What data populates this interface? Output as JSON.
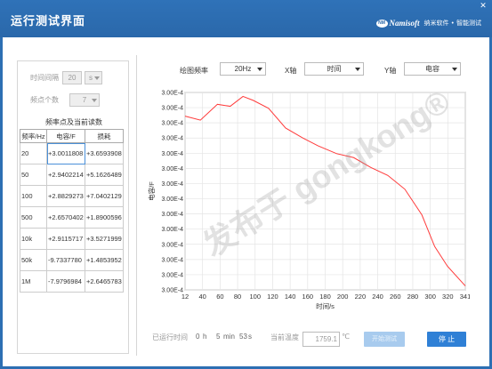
{
  "window": {
    "title": "运行测试界面",
    "close_glyph": "✕"
  },
  "brand": {
    "logo_text": "NM",
    "name": "Namisoft",
    "company": "纳米软件",
    "dot": "•",
    "product": "智能测试"
  },
  "left": {
    "interval": {
      "label": "时间间隔",
      "value": "20",
      "unit": "s"
    },
    "freq_count": {
      "label": "频点个数",
      "value": "7"
    },
    "table_title": "频率点及当前读数",
    "columns": [
      "频率/Hz",
      "电容/F",
      "损耗"
    ],
    "rows": [
      [
        "20",
        "+3.0011808",
        "+3.6593908"
      ],
      [
        "50",
        "+2.9402214",
        "+5.1626489"
      ],
      [
        "100",
        "+2.8829273",
        "+7.0402129"
      ],
      [
        "500",
        "+2.6570402",
        "+1.8900596"
      ],
      [
        "10k",
        "+2.9115717",
        "+3.5271999"
      ],
      [
        "50k",
        "-9.7337780",
        "+1.4853952"
      ],
      [
        "1M",
        "-7.9796984",
        "+2.6465783"
      ]
    ]
  },
  "controls": {
    "plot_freq": {
      "label": "绘图频率",
      "value": "20Hz"
    },
    "x_axis": {
      "label": "X轴",
      "value": "时间"
    },
    "y_axis": {
      "label": "Y轴",
      "value": "电容"
    }
  },
  "chart_data": {
    "type": "line",
    "xlabel": "时间/s",
    "ylabel": "电容/F",
    "x_ticks": [
      "12",
      "40",
      "60",
      "80",
      "100",
      "120",
      "140",
      "160",
      "180",
      "200",
      "220",
      "240",
      "260",
      "280",
      "300",
      "320",
      "341"
    ],
    "y_tick_labels": [
      "3.00E-4",
      "3.00E-4",
      "3.00E-4",
      "3.00E-4",
      "3.00E-4",
      "3.00E-4",
      "3.00E-4",
      "3.00E-4",
      "3.00E-4",
      "3.00E-4",
      "3.00E-4",
      "3.00E-4",
      "3.00E-4",
      "3.00E-4"
    ],
    "xlim": [
      12,
      341
    ],
    "grid": true,
    "series_color": "#ff3b3b",
    "series": [
      {
        "x": [
          12,
          30,
          50,
          65,
          80,
          92,
          110,
          130,
          150,
          168,
          190,
          210,
          230,
          250,
          270,
          290,
          305,
          320,
          341
        ],
        "y": [
          0.88,
          0.86,
          0.94,
          0.93,
          0.98,
          0.96,
          0.92,
          0.82,
          0.77,
          0.73,
          0.69,
          0.67,
          0.62,
          0.58,
          0.51,
          0.38,
          0.22,
          0.12,
          0.02
        ]
      }
    ]
  },
  "status": {
    "elapsed_label": "已运行时间",
    "hours": "0",
    "h_unit": "h",
    "minutes": "5",
    "min_unit": "min",
    "seconds": "53",
    "s_unit": "s",
    "temp_label": "当前温度",
    "temp_value": "1759.1",
    "temp_unit": "℃"
  },
  "buttons": {
    "start": "开始测试",
    "stop": "停 止"
  },
  "watermark": "发布于 gongkong®",
  "colors": {
    "titlebar": "#2a68aa",
    "stop_button": "#2f80d6",
    "start_button_disabled": "#a8cbee"
  }
}
